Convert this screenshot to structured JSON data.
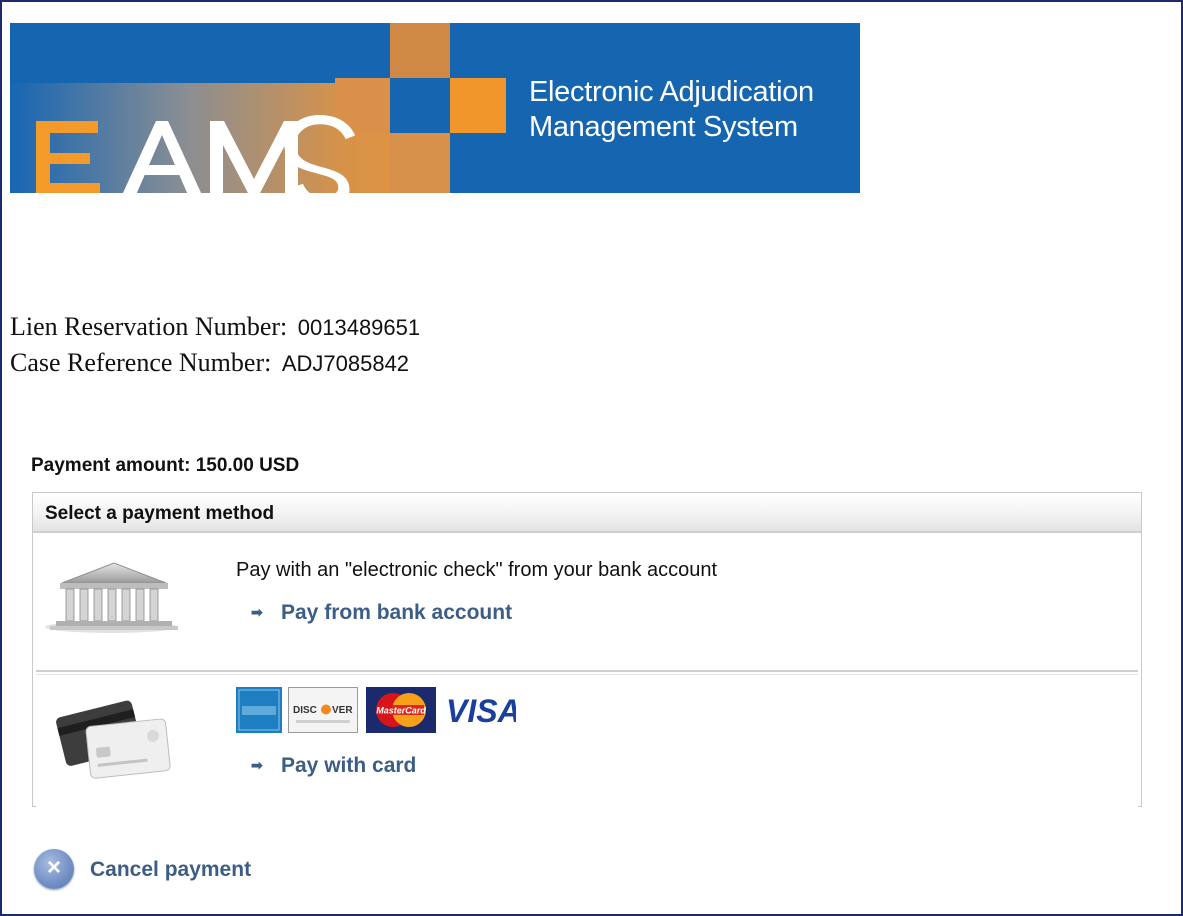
{
  "banner": {
    "logo_text": "EAMS",
    "title_line1": "Electronic Adjudication",
    "title_line2": "Management System"
  },
  "reference": {
    "lien_label": "Lien Reservation Number:",
    "lien_value": "0013489651",
    "case_label": "Case Reference Number:",
    "case_value": "ADJ7085842"
  },
  "payment": {
    "amount_text": "Payment amount: 150.00 USD",
    "panel_title": "Select a payment method",
    "bank": {
      "description": "Pay with an \"electronic check\" from your bank account",
      "link_label": "Pay from bank account",
      "icon": "bank-building-icon"
    },
    "card": {
      "link_label": "Pay with card",
      "icon": "credit-cards-icon",
      "logos": [
        "AMERICAN EXPRESS",
        "DISCOVER",
        "MasterCard",
        "VISA"
      ]
    }
  },
  "cancel_label": "Cancel payment",
  "colors": {
    "banner_blue": "#1565b0",
    "banner_orange": "#f0962b",
    "link_blue": "#3c5d86",
    "page_border": "#1d2a6b"
  }
}
